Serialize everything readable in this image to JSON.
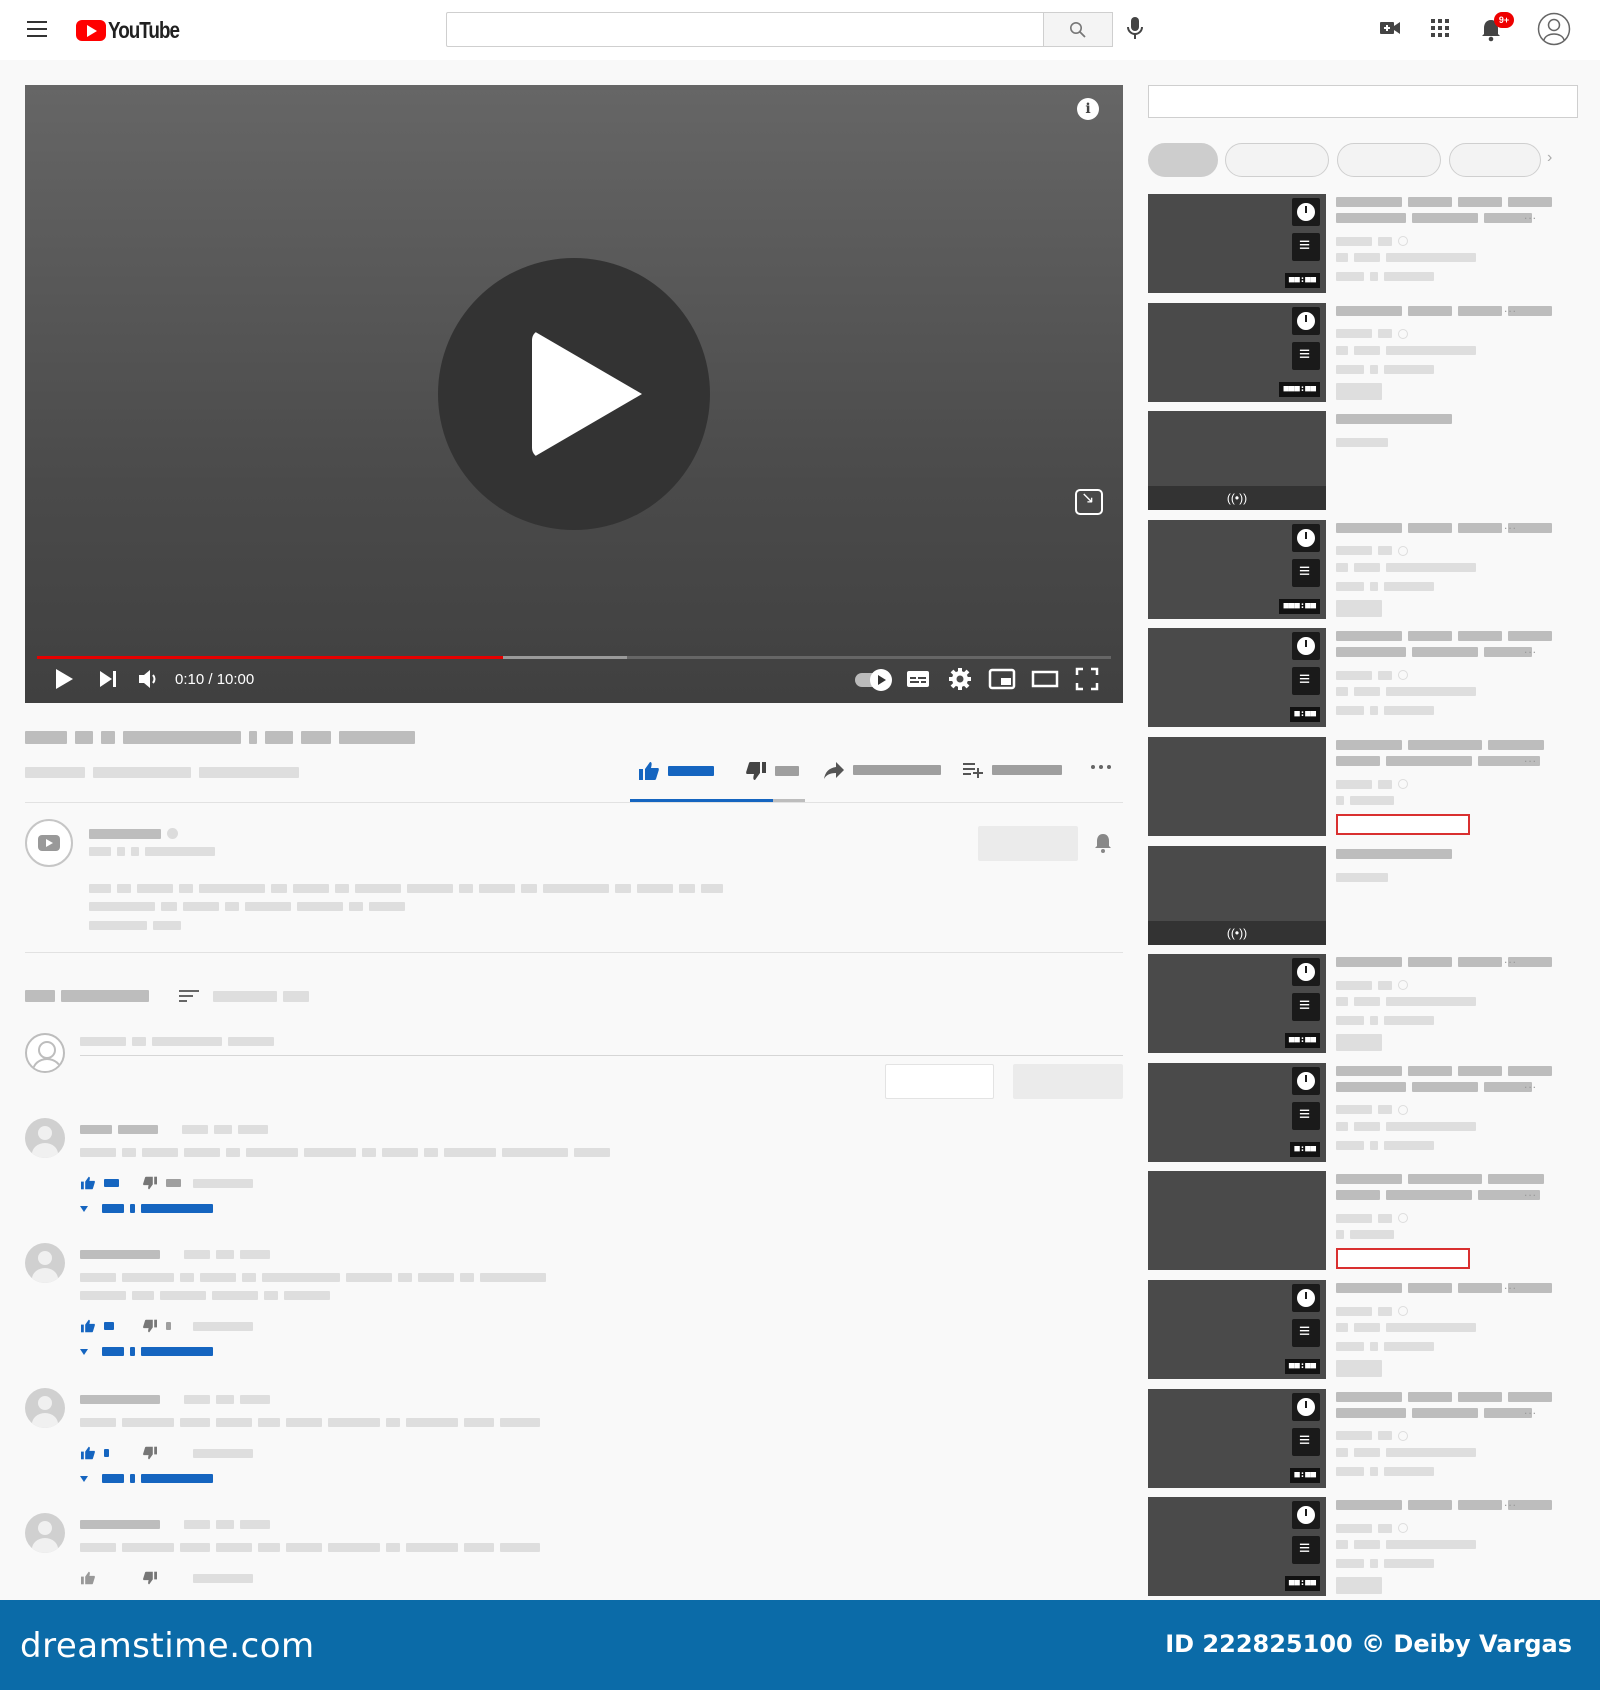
{
  "header": {
    "logo_text": "YouTube",
    "notification_count": "9+"
  },
  "player": {
    "time_display": "0:10 / 10:00",
    "progress_fraction": 0.434,
    "buffer_fraction": 0.549,
    "info_glyph": "i"
  },
  "sidebar": {
    "live_glyph": "((•))",
    "ellipsis": "..."
  },
  "footer": {
    "brand": "dreamstime.com",
    "credit": "ID 222825100 © Deiby Vargas"
  },
  "colors": {
    "accent_red": "#e60000",
    "brand_red": "#ff0000",
    "link_blue": "#1565c0",
    "footer_blue": "#0b6ba8"
  },
  "icons": [
    "menu-icon",
    "search-icon",
    "mic-icon",
    "create-video-icon",
    "apps-grid-icon",
    "bell-icon",
    "account-icon",
    "play-icon",
    "next-icon",
    "volume-icon",
    "autoplay-toggle",
    "captions-icon",
    "settings-icon",
    "miniplayer-icon",
    "theater-icon",
    "fullscreen-icon",
    "like-icon",
    "dislike-icon",
    "share-icon",
    "save-icon",
    "more-icon",
    "sort-icon",
    "clock-icon",
    "queue-icon",
    "live-icon"
  ]
}
